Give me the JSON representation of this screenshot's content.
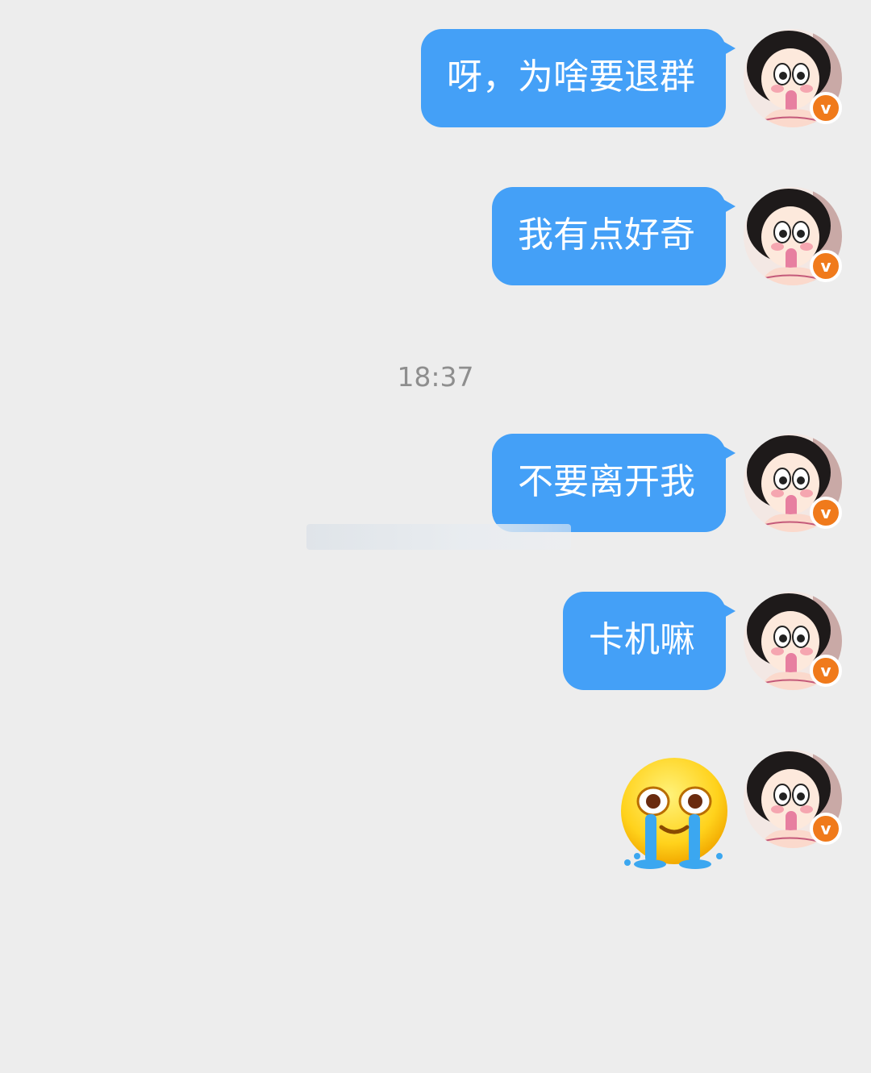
{
  "colors": {
    "background": "#ededed",
    "bubble": "#44a0f7",
    "bubble_text": "#ffffff",
    "timestamp": "#8e8e8e",
    "badge": "#f07a1b"
  },
  "messages": [
    {
      "text": "呀，为啥要退群",
      "type": "text"
    },
    {
      "text": "我有点好奇",
      "type": "text"
    },
    {
      "text": "不要离开我",
      "type": "text"
    },
    {
      "text": "卡机嘛",
      "type": "text"
    },
    {
      "type": "emoji",
      "icon": "crying-face-emoji"
    }
  ],
  "timestamp": "18:37",
  "avatar": {
    "badge_label": "v",
    "icon": "anime-girl-avatar"
  }
}
